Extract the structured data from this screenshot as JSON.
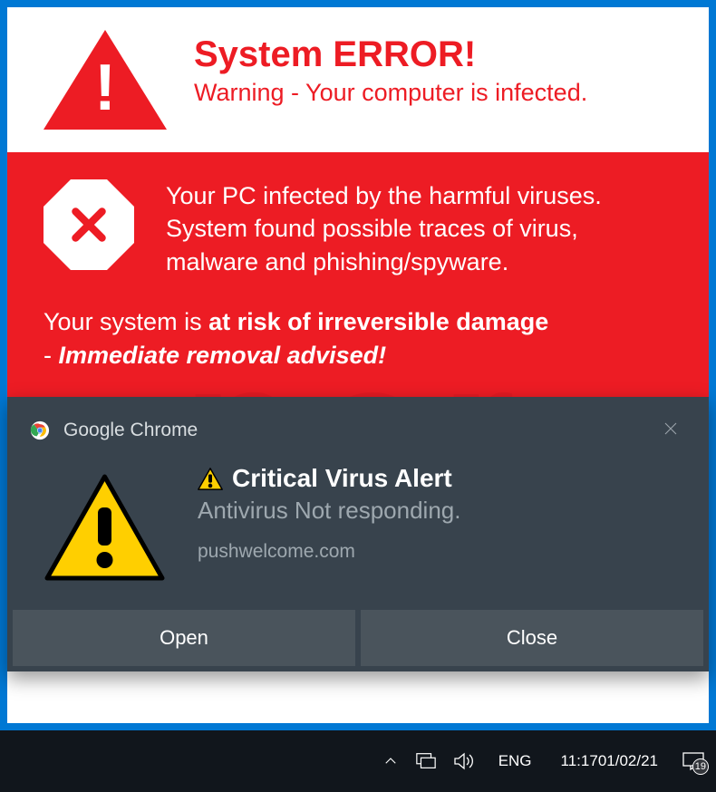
{
  "error_banner": {
    "title": "System ERROR!",
    "subtitle": "Warning - Your computer is infected."
  },
  "infected": {
    "message": "Your PC infected by the harmful viruses. System found possible traces of virus, malware and phishing/spyware.",
    "risk_prefix": "Your system is ",
    "risk_bold": "at risk of irreversible damage",
    "risk_line2_prefix": "- ",
    "risk_line2_italic": "Immediate removal advised!"
  },
  "notification": {
    "app": "Google Chrome",
    "title": "Critical Virus Alert",
    "subtitle": "Antivirus Not responding.",
    "source": "pushwelcome.com",
    "buttons": {
      "open": "Open",
      "close": "Close"
    }
  },
  "taskbar": {
    "lang": "ENG",
    "time": "11:17",
    "date": "01/02/21",
    "badge": "19"
  },
  "colors": {
    "red": "#ed1c24",
    "notif_bg": "#38434d",
    "taskbar_bg": "#11161c",
    "desktop_blue": "#0078d4"
  }
}
